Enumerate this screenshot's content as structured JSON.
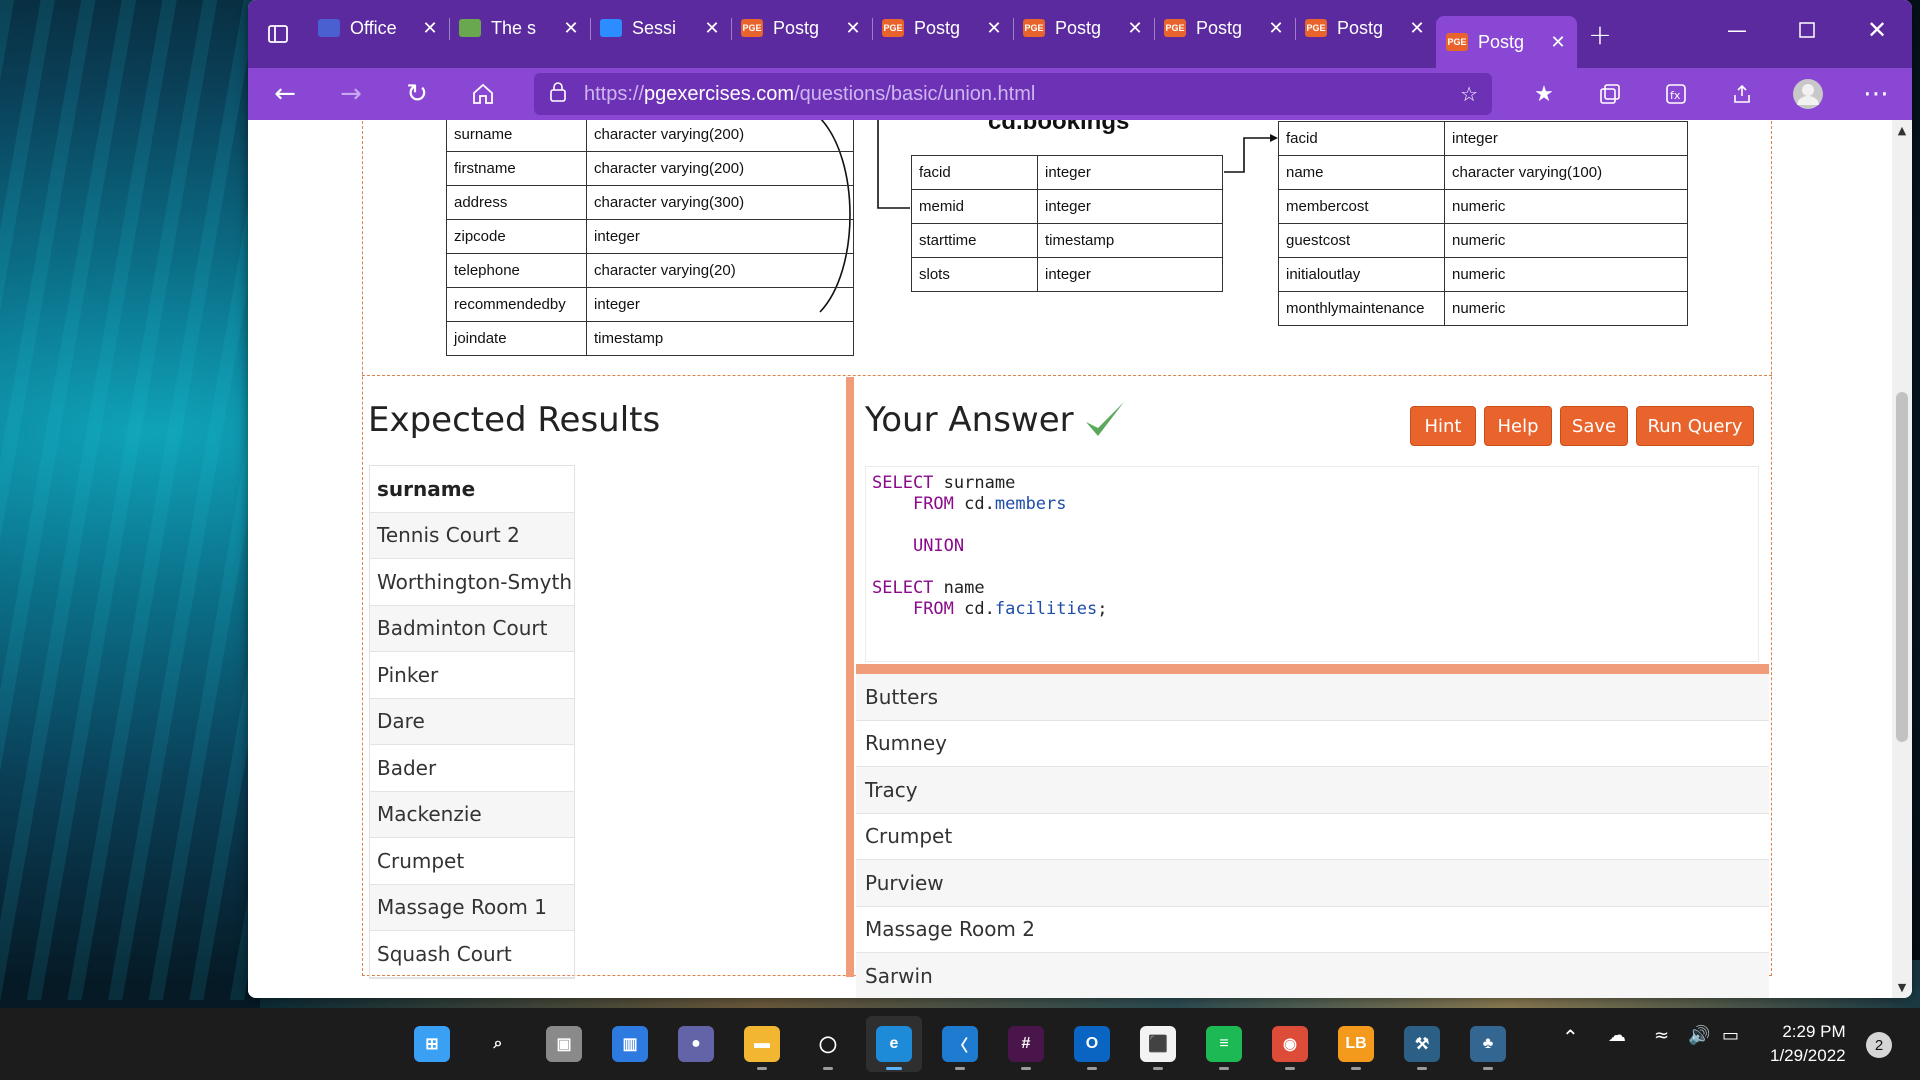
{
  "browser": {
    "tabs": [
      {
        "label": "Office",
        "favicon": "zoom-icon",
        "color": "#4a5fd0"
      },
      {
        "label": "The s",
        "favicon": "chart-icon",
        "color": "#6aa84f"
      },
      {
        "label": "Sessi",
        "favicon": "zoom-icon",
        "color": "#2d8cff"
      },
      {
        "label": "Postg",
        "favicon": "pge-icon",
        "color": "#e8642c"
      },
      {
        "label": "Postg",
        "favicon": "pge-icon",
        "color": "#e8642c"
      },
      {
        "label": "Postg",
        "favicon": "pge-icon",
        "color": "#e8642c"
      },
      {
        "label": "Postg",
        "favicon": "pge-icon",
        "color": "#e8642c"
      },
      {
        "label": "Postg",
        "favicon": "pge-icon",
        "color": "#e8642c"
      },
      {
        "label": "Postg",
        "favicon": "pge-icon",
        "color": "#e8642c",
        "active": true
      }
    ],
    "favicon_text": "PGE",
    "url_prefix": "https://",
    "url_host": "pgexercises.com",
    "url_path": "/questions/basic/union.html",
    "theme_color": "#5b2a9e",
    "toolbar_color": "#8a47d3"
  },
  "schema": {
    "members_rows": [
      [
        "surname",
        "character varying(200)"
      ],
      [
        "firstname",
        "character varying(200)"
      ],
      [
        "address",
        "character varying(300)"
      ],
      [
        "zipcode",
        "integer"
      ],
      [
        "telephone",
        "character varying(20)"
      ],
      [
        "recommendedby",
        "integer"
      ],
      [
        "joindate",
        "timestamp"
      ]
    ],
    "bookings_title": "cd.bookings",
    "bookings_rows": [
      [
        "facid",
        "integer"
      ],
      [
        "memid",
        "integer"
      ],
      [
        "starttime",
        "timestamp"
      ],
      [
        "slots",
        "integer"
      ]
    ],
    "facilities_rows": [
      [
        "facid",
        "integer"
      ],
      [
        "name",
        "character varying(100)"
      ],
      [
        "membercost",
        "numeric"
      ],
      [
        "guestcost",
        "numeric"
      ],
      [
        "initialoutlay",
        "numeric"
      ],
      [
        "monthlymaintenance",
        "numeric"
      ]
    ]
  },
  "expected": {
    "title": "Expected Results",
    "header": "surname",
    "rows": [
      "Tennis Court 2",
      "Worthington-Smyth",
      "Badminton Court",
      "Pinker",
      "Dare",
      "Bader",
      "Mackenzie",
      "Crumpet",
      "Massage Room 1",
      "Squash Court"
    ]
  },
  "answer": {
    "title": "Your Answer",
    "status": "correct",
    "buttons": {
      "hint": "Hint",
      "help": "Help",
      "save": "Save",
      "run": "Run Query"
    },
    "sql": {
      "l1_kw": "SELECT",
      "l1_rest": " surname",
      "l2_kw": "FROM",
      "l2_schema": " cd.",
      "l2_table": "members",
      "l3_kw": "UNION",
      "l4_kw": "SELECT",
      "l4_rest": " name",
      "l5_kw": "FROM",
      "l5_schema": " cd.",
      "l5_table": "facilities",
      "l5_end": ";"
    },
    "results": [
      "Butters",
      "Rumney",
      "Tracy",
      "Crumpet",
      "Purview",
      "Massage Room 2",
      "Sarwin"
    ]
  },
  "taskbar": {
    "time": "2:29 PM",
    "date": "1/29/2022",
    "notifications": "2"
  }
}
